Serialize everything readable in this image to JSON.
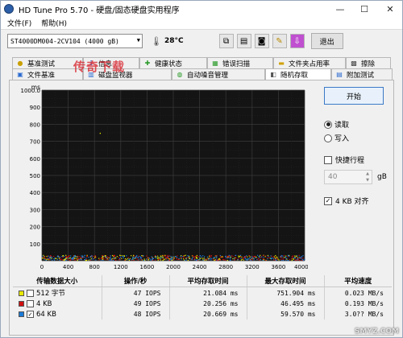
{
  "window": {
    "title": "HD Tune Pro 5.70 - 硬盘/固态硬盘实用程序",
    "minimize": "—",
    "maximize": "☐",
    "close": "✕"
  },
  "menu": [
    "文件(F)",
    "帮助(H)"
  ],
  "toolbar": {
    "drive": "ST4000DM004-2CV104 (4000 gB)",
    "temperature": "28°C",
    "exit_label": "退出",
    "icons": [
      "copy-icon",
      "copy-info-icon",
      "camera-icon",
      "settings-icon",
      "save-icon"
    ]
  },
  "tabs_row1": [
    {
      "label": "基准测试",
      "icon": "benchmark-icon"
    },
    {
      "label": "信息",
      "icon": "info-icon"
    },
    {
      "label": "健康状态",
      "icon": "health-icon"
    },
    {
      "label": "错误扫描",
      "icon": "error-scan-icon"
    },
    {
      "label": "文件夹占用率",
      "icon": "folder-icon"
    },
    {
      "label": "擦除",
      "icon": "erase-icon"
    }
  ],
  "tabs_row2": [
    {
      "label": "文件基准",
      "icon": "file-benchmark-icon"
    },
    {
      "label": "磁盘监视器",
      "icon": "disk-monitor-icon"
    },
    {
      "label": "自动噪音管理",
      "icon": "noise-icon"
    },
    {
      "label": "随机存取",
      "icon": "random-access-icon",
      "active": true
    },
    {
      "label": "附加测试",
      "icon": "extra-tests-icon"
    }
  ],
  "watermark": "传奇下载",
  "watermark2": "SMYZ.COM",
  "controls": {
    "start_label": "开始",
    "read_label": "读取",
    "write_label": "写入",
    "read_selected": true,
    "fast_label": "快捷行程",
    "fast_checked": false,
    "size_value": "40",
    "size_unit": "gB",
    "align_label": "4 KB 对齐",
    "align_checked": true
  },
  "chart_data": {
    "type": "scatter",
    "yunit": "ms",
    "xunit": "gB",
    "yticks": [
      "1000.0",
      "900",
      "800",
      "700",
      "600",
      "500",
      "400",
      "300",
      "200",
      "100"
    ],
    "xticks": [
      "0",
      "400",
      "800",
      "1200",
      "1600",
      "2000",
      "2400",
      "2800",
      "3200",
      "3600",
      "4000gB"
    ],
    "xlim": [
      0,
      4000
    ],
    "ylim": [
      0,
      1000
    ],
    "grid": true,
    "series": [
      {
        "name": "512 字节",
        "color": "#e8e800",
        "approx_y_range": [
          0,
          30
        ]
      },
      {
        "name": "4 KB",
        "color": "#d01010",
        "approx_y_range": [
          0,
          30
        ]
      },
      {
        "name": "64 KB",
        "color": "#1a7ad8",
        "approx_y_range": [
          0,
          30
        ]
      }
    ]
  },
  "results": {
    "headers": [
      "传输数据大小",
      "操作/秒",
      "平均存取时间",
      "最大存取时间",
      "平均速度"
    ],
    "rows": [
      {
        "size": "512 字节",
        "color": "#e8e800",
        "ops": "47 IOPS",
        "avg": "21.084 ms",
        "max": "751.904 ms",
        "speed": "0.023 MB/s"
      },
      {
        "size": "4 KB",
        "color": "#d01010",
        "ops": "49 IOPS",
        "avg": "20.256 ms",
        "max": "46.495 ms",
        "speed": "0.193 MB/s"
      },
      {
        "size": "64 KB",
        "color": "#1a7ad8",
        "ops": "48 IOPS",
        "avg": "20.669 ms",
        "max": "59.570 ms",
        "speed": "3.0?? MB/s"
      }
    ]
  }
}
